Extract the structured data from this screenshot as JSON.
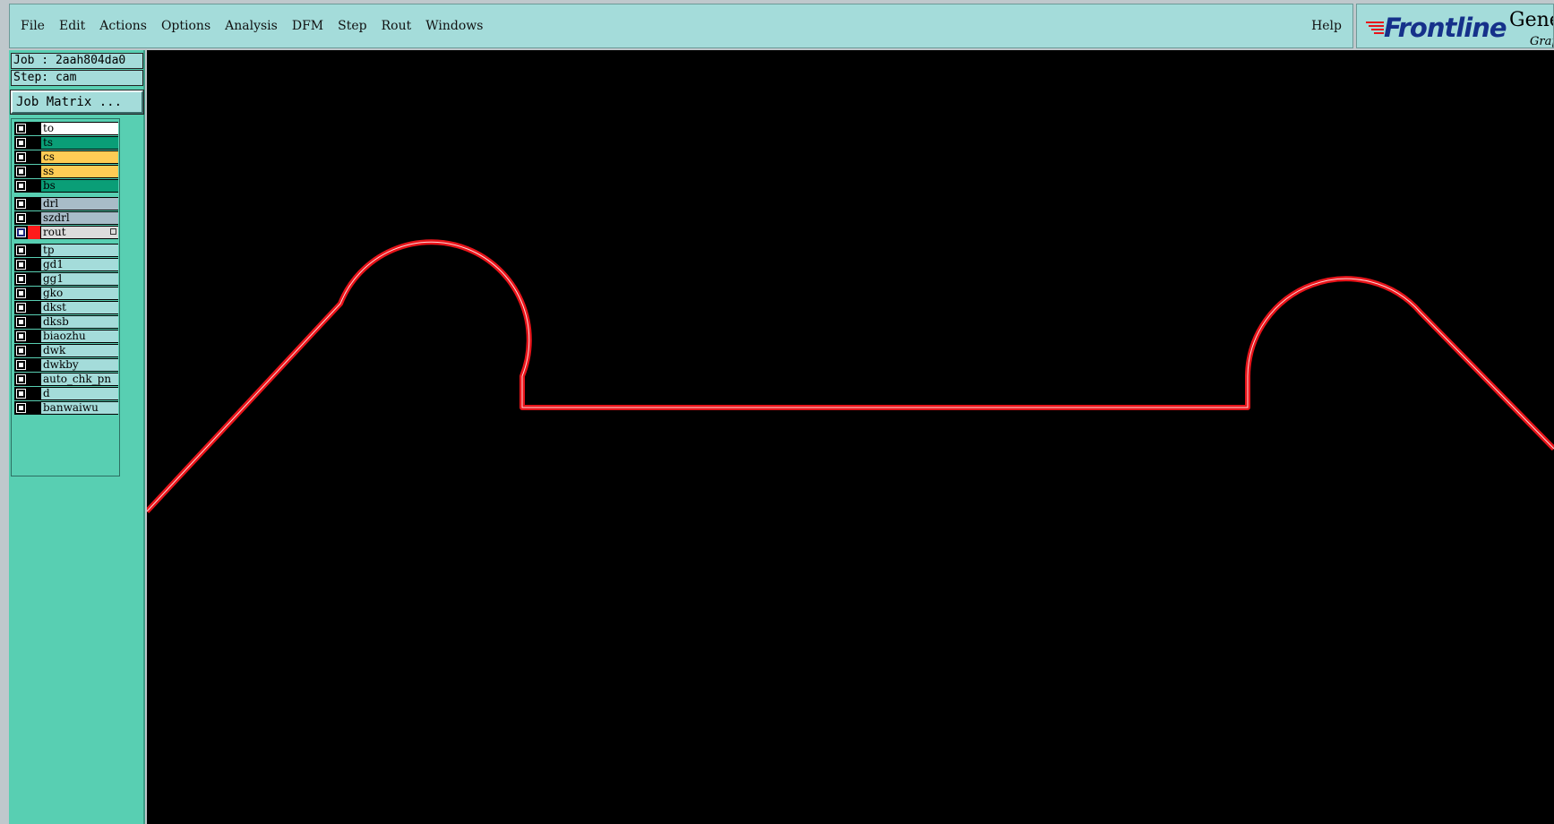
{
  "menu": {
    "items": [
      "File",
      "Edit",
      "Actions",
      "Options",
      "Analysis",
      "DFM",
      "Step",
      "Rout",
      "Windows"
    ],
    "help": "Help"
  },
  "logo": {
    "brand": "Frontline",
    "product": "Gene",
    "tagline": "Grap"
  },
  "job": {
    "job_line": "Job : 2aah804da0",
    "step_line": "Step: cam",
    "matrix_button": "Job Matrix ..."
  },
  "layers": [
    {
      "name": "to",
      "color": "#ffffff",
      "checked": false,
      "swatch": "#000000"
    },
    {
      "name": "ts",
      "color": "#0a9e77",
      "checked": false,
      "swatch": "#000000"
    },
    {
      "name": "cs",
      "color": "#ffcc55",
      "checked": false,
      "swatch": "#000000"
    },
    {
      "name": "ss",
      "color": "#ffcc55",
      "checked": false,
      "swatch": "#000000"
    },
    {
      "name": "bs",
      "color": "#0a9e77",
      "checked": false,
      "swatch": "#000000"
    },
    {
      "name": "drl",
      "color": "#a8bcc8",
      "checked": false,
      "swatch": "#000000"
    },
    {
      "name": "szdrl",
      "color": "#a8bcc8",
      "checked": false,
      "swatch": "#000000"
    },
    {
      "name": "rout",
      "color": "#dcdcdc",
      "checked": true,
      "swatch": "#ff1a1a"
    },
    {
      "name": "tp",
      "color": "#a4dcda",
      "checked": false,
      "swatch": "#000000"
    },
    {
      "name": "gd1",
      "color": "#a4dcda",
      "checked": false,
      "swatch": "#000000"
    },
    {
      "name": "gg1",
      "color": "#a4dcda",
      "checked": false,
      "swatch": "#000000"
    },
    {
      "name": "gko",
      "color": "#a4dcda",
      "checked": false,
      "swatch": "#000000"
    },
    {
      "name": "dkst",
      "color": "#a4dcda",
      "checked": false,
      "swatch": "#000000"
    },
    {
      "name": "dksb",
      "color": "#a4dcda",
      "checked": false,
      "swatch": "#000000"
    },
    {
      "name": "biaozhu",
      "color": "#a4dcda",
      "checked": false,
      "swatch": "#000000"
    },
    {
      "name": "dwk",
      "color": "#a4dcda",
      "checked": false,
      "swatch": "#000000"
    },
    {
      "name": "dwkby",
      "color": "#a4dcda",
      "checked": false,
      "swatch": "#000000"
    },
    {
      "name": "auto_chk_pn",
      "color": "#a4dcda",
      "checked": false,
      "swatch": "#000000"
    },
    {
      "name": "d",
      "color": "#a4dcda",
      "checked": false,
      "swatch": "#000000"
    },
    {
      "name": "banwaiwu",
      "color": "#a4dcda",
      "checked": false,
      "swatch": "#000000"
    }
  ],
  "colors": {
    "menubar": "#a4dcda",
    "panel": "#58cfb2",
    "canvas": "#000000",
    "outline": "#e8141a"
  }
}
